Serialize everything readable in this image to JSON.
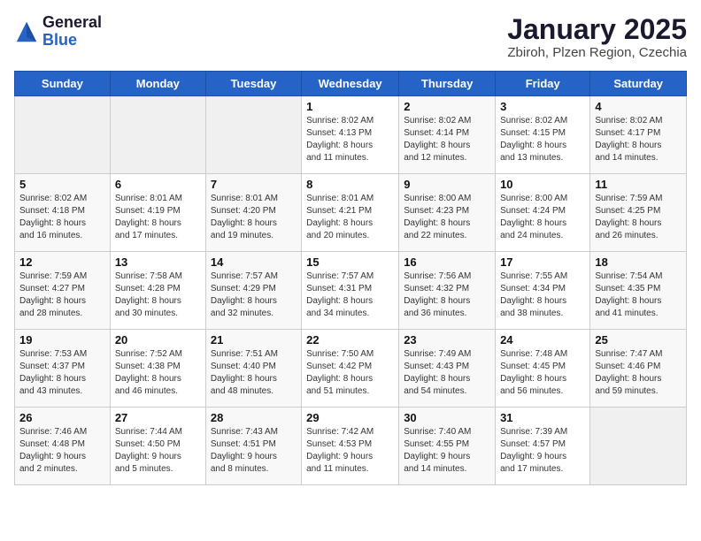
{
  "logo": {
    "general": "General",
    "blue": "Blue"
  },
  "title": "January 2025",
  "subtitle": "Zbiroh, Plzen Region, Czechia",
  "days_header": [
    "Sunday",
    "Monday",
    "Tuesday",
    "Wednesday",
    "Thursday",
    "Friday",
    "Saturday"
  ],
  "weeks": [
    [
      {
        "day": "",
        "info": ""
      },
      {
        "day": "",
        "info": ""
      },
      {
        "day": "",
        "info": ""
      },
      {
        "day": "1",
        "info": "Sunrise: 8:02 AM\nSunset: 4:13 PM\nDaylight: 8 hours\nand 11 minutes."
      },
      {
        "day": "2",
        "info": "Sunrise: 8:02 AM\nSunset: 4:14 PM\nDaylight: 8 hours\nand 12 minutes."
      },
      {
        "day": "3",
        "info": "Sunrise: 8:02 AM\nSunset: 4:15 PM\nDaylight: 8 hours\nand 13 minutes."
      },
      {
        "day": "4",
        "info": "Sunrise: 8:02 AM\nSunset: 4:17 PM\nDaylight: 8 hours\nand 14 minutes."
      }
    ],
    [
      {
        "day": "5",
        "info": "Sunrise: 8:02 AM\nSunset: 4:18 PM\nDaylight: 8 hours\nand 16 minutes."
      },
      {
        "day": "6",
        "info": "Sunrise: 8:01 AM\nSunset: 4:19 PM\nDaylight: 8 hours\nand 17 minutes."
      },
      {
        "day": "7",
        "info": "Sunrise: 8:01 AM\nSunset: 4:20 PM\nDaylight: 8 hours\nand 19 minutes."
      },
      {
        "day": "8",
        "info": "Sunrise: 8:01 AM\nSunset: 4:21 PM\nDaylight: 8 hours\nand 20 minutes."
      },
      {
        "day": "9",
        "info": "Sunrise: 8:00 AM\nSunset: 4:23 PM\nDaylight: 8 hours\nand 22 minutes."
      },
      {
        "day": "10",
        "info": "Sunrise: 8:00 AM\nSunset: 4:24 PM\nDaylight: 8 hours\nand 24 minutes."
      },
      {
        "day": "11",
        "info": "Sunrise: 7:59 AM\nSunset: 4:25 PM\nDaylight: 8 hours\nand 26 minutes."
      }
    ],
    [
      {
        "day": "12",
        "info": "Sunrise: 7:59 AM\nSunset: 4:27 PM\nDaylight: 8 hours\nand 28 minutes."
      },
      {
        "day": "13",
        "info": "Sunrise: 7:58 AM\nSunset: 4:28 PM\nDaylight: 8 hours\nand 30 minutes."
      },
      {
        "day": "14",
        "info": "Sunrise: 7:57 AM\nSunset: 4:29 PM\nDaylight: 8 hours\nand 32 minutes."
      },
      {
        "day": "15",
        "info": "Sunrise: 7:57 AM\nSunset: 4:31 PM\nDaylight: 8 hours\nand 34 minutes."
      },
      {
        "day": "16",
        "info": "Sunrise: 7:56 AM\nSunset: 4:32 PM\nDaylight: 8 hours\nand 36 minutes."
      },
      {
        "day": "17",
        "info": "Sunrise: 7:55 AM\nSunset: 4:34 PM\nDaylight: 8 hours\nand 38 minutes."
      },
      {
        "day": "18",
        "info": "Sunrise: 7:54 AM\nSunset: 4:35 PM\nDaylight: 8 hours\nand 41 minutes."
      }
    ],
    [
      {
        "day": "19",
        "info": "Sunrise: 7:53 AM\nSunset: 4:37 PM\nDaylight: 8 hours\nand 43 minutes."
      },
      {
        "day": "20",
        "info": "Sunrise: 7:52 AM\nSunset: 4:38 PM\nDaylight: 8 hours\nand 46 minutes."
      },
      {
        "day": "21",
        "info": "Sunrise: 7:51 AM\nSunset: 4:40 PM\nDaylight: 8 hours\nand 48 minutes."
      },
      {
        "day": "22",
        "info": "Sunrise: 7:50 AM\nSunset: 4:42 PM\nDaylight: 8 hours\nand 51 minutes."
      },
      {
        "day": "23",
        "info": "Sunrise: 7:49 AM\nSunset: 4:43 PM\nDaylight: 8 hours\nand 54 minutes."
      },
      {
        "day": "24",
        "info": "Sunrise: 7:48 AM\nSunset: 4:45 PM\nDaylight: 8 hours\nand 56 minutes."
      },
      {
        "day": "25",
        "info": "Sunrise: 7:47 AM\nSunset: 4:46 PM\nDaylight: 8 hours\nand 59 minutes."
      }
    ],
    [
      {
        "day": "26",
        "info": "Sunrise: 7:46 AM\nSunset: 4:48 PM\nDaylight: 9 hours\nand 2 minutes."
      },
      {
        "day": "27",
        "info": "Sunrise: 7:44 AM\nSunset: 4:50 PM\nDaylight: 9 hours\nand 5 minutes."
      },
      {
        "day": "28",
        "info": "Sunrise: 7:43 AM\nSunset: 4:51 PM\nDaylight: 9 hours\nand 8 minutes."
      },
      {
        "day": "29",
        "info": "Sunrise: 7:42 AM\nSunset: 4:53 PM\nDaylight: 9 hours\nand 11 minutes."
      },
      {
        "day": "30",
        "info": "Sunrise: 7:40 AM\nSunset: 4:55 PM\nDaylight: 9 hours\nand 14 minutes."
      },
      {
        "day": "31",
        "info": "Sunrise: 7:39 AM\nSunset: 4:57 PM\nDaylight: 9 hours\nand 17 minutes."
      },
      {
        "day": "",
        "info": ""
      }
    ]
  ]
}
